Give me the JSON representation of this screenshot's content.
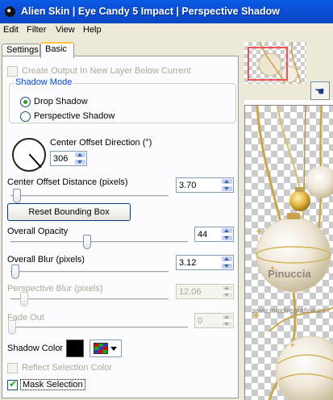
{
  "window": {
    "title": "Alien Skin | Eye Candy 5 Impact | Perspective Shadow"
  },
  "menu": [
    "Edit",
    "Filter",
    "View",
    "Help"
  ],
  "tabs": [
    "Settings",
    "Basic"
  ],
  "basic": {
    "create_output_label": "Create Output In New Layer Below Current",
    "shadow_mode": {
      "title": "Shadow Mode",
      "options": [
        "Drop Shadow",
        "Perspective Shadow"
      ],
      "selected": "Drop Shadow"
    },
    "center_offset_direction": {
      "label": "Center Offset Direction (°)",
      "value": "306"
    },
    "center_offset_distance": {
      "label": "Center Offset Distance (pixels)",
      "value": "3.70",
      "level": 0.03
    },
    "reset_button": "Reset Bounding Box",
    "overall_opacity": {
      "label": "Overall Opacity",
      "value": "44",
      "level": 0.44
    },
    "overall_blur": {
      "label": "Overall Blur (pixels)",
      "value": "3.12",
      "level": 0.02
    },
    "perspective_blur": {
      "label": "Perspective Blur (pixels)",
      "value": "12.06",
      "level": 0.08
    },
    "fade_out": {
      "label": "Fade Out",
      "value": "0",
      "level": 0.0
    },
    "shadow_color": {
      "label": "Shadow Color",
      "value": "#000000"
    },
    "reflect_selection_color_label": "Reflect Selection Color",
    "mask_selection": {
      "label": "Mask Selection",
      "checked": true
    }
  },
  "watermark": {
    "line1": "Pinuccia",
    "line2": "www.maidiregrafica.eu"
  },
  "colors": {
    "titlebar": "#0b4fd6",
    "accent_check": "#21a121",
    "group_title": "#0046d5"
  }
}
